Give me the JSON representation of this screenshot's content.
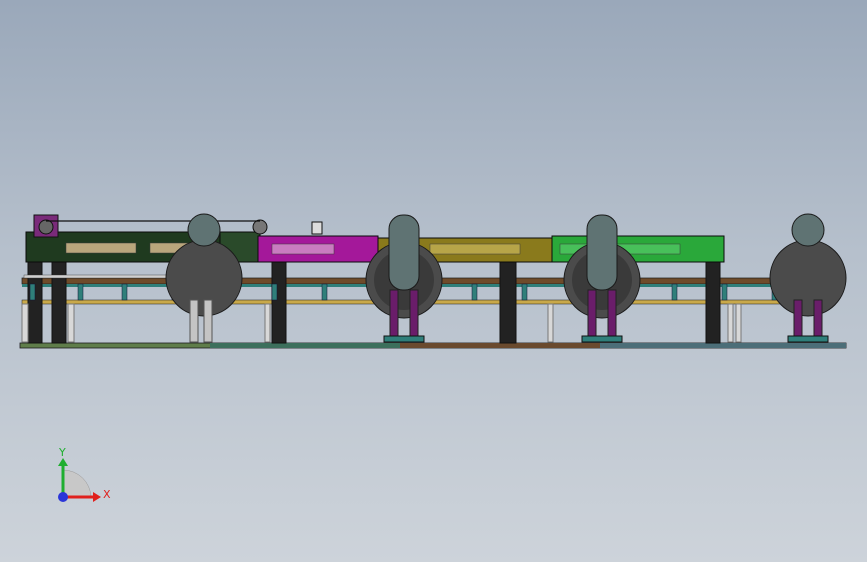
{
  "view": {
    "background_top": "#9aa8ba",
    "background_bottom": "#cdd3da",
    "section_colors": [
      "#1f3a1f",
      "#a4189a",
      "#8a7a1c",
      "#2aa83a"
    ]
  },
  "triad": {
    "y_label": "Y",
    "x_label": "X",
    "x_color": "#e0201c",
    "y_color": "#1fae2f",
    "z_color": "#2a35d8"
  },
  "model": {
    "parts": [
      "frame-rail",
      "support-leg",
      "reel-drum",
      "conveyor-section-dark-green",
      "conveyor-section-magenta",
      "conveyor-section-olive",
      "conveyor-section-green",
      "base-beam"
    ]
  }
}
